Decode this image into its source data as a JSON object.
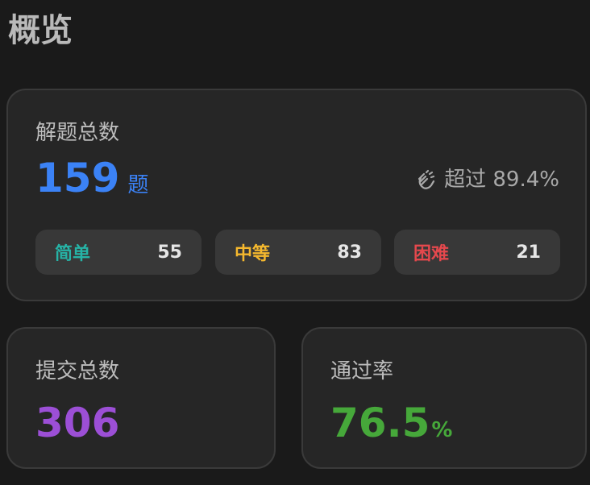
{
  "page": {
    "title": "概览"
  },
  "solved": {
    "label": "解题总数",
    "count": "159",
    "unit": "题",
    "beat_icon": "clapping-hands-icon",
    "beat_text": "超过 89.4%",
    "difficulties": [
      {
        "label": "简单",
        "count": "55",
        "color": "#26b3a6"
      },
      {
        "label": "中等",
        "count": "83",
        "color": "#f5b82e"
      },
      {
        "label": "困难",
        "count": "21",
        "color": "#e5484d"
      }
    ]
  },
  "submissions": {
    "label": "提交总数",
    "count": "306"
  },
  "acceptance": {
    "label": "通过率",
    "value": "76.5",
    "unit": "%"
  },
  "colors": {
    "background": "#1a1a1a",
    "card": "#262626",
    "solved": "#3b82f6",
    "submissions": "#9c4fd6",
    "acceptance": "#46a83a"
  }
}
